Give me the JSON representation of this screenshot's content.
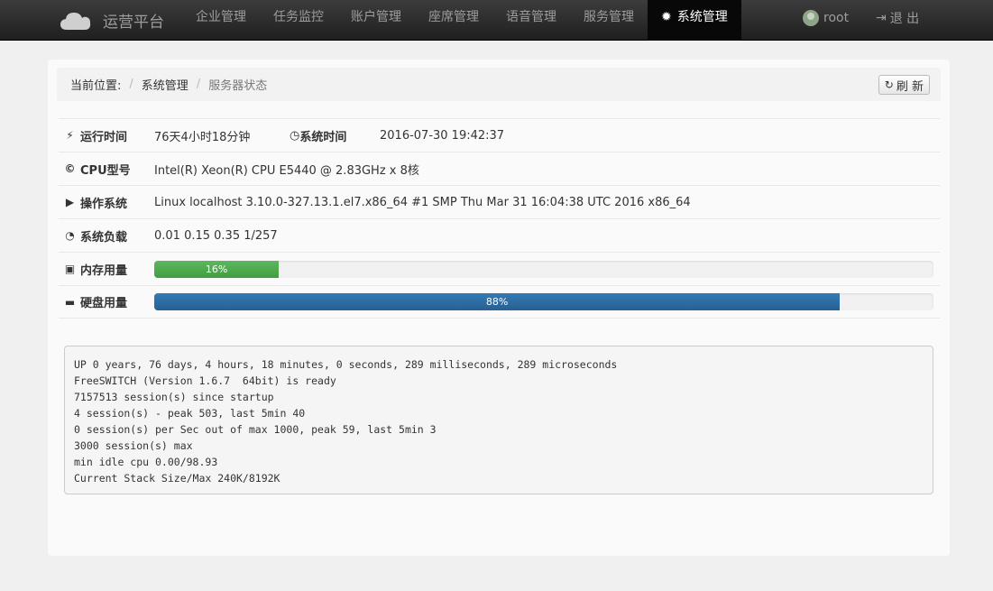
{
  "nav": {
    "brand": "运营平台",
    "items": [
      "企业管理",
      "任务监控",
      "账户管理",
      "座席管理",
      "语音管理",
      "服务管理"
    ],
    "active": "系统管理",
    "user": "root",
    "logout": "退 出"
  },
  "breadcrumb": {
    "prefix": "当前位置:",
    "level1": "系统管理",
    "level2": "服务器状态",
    "refresh": "刷 新"
  },
  "status": {
    "uptime_label": "运行时间",
    "uptime_value": "76天4小时18分钟",
    "systime_label": "系统时间",
    "systime_value": "2016-07-30 19:42:37",
    "cpu_label": "CPU型号",
    "cpu_value": "Intel(R) Xeon(R) CPU E5440 @ 2.83GHz x 8核",
    "os_label": "操作系统",
    "os_value": "Linux localhost 3.10.0-327.13.1.el7.x86_64 #1 SMP Thu Mar 31 16:04:38 UTC 2016 x86_64",
    "load_label": "系统负载",
    "load_value": "0.01 0.15 0.35 1/257",
    "mem_label": "内存用量",
    "mem_percent": 16,
    "mem_text": "16%",
    "disk_label": "硬盘用量",
    "disk_percent": 88,
    "disk_text": "88%"
  },
  "console": "UP 0 years, 76 days, 4 hours, 18 minutes, 0 seconds, 289 milliseconds, 289 microseconds\nFreeSWITCH (Version 1.6.7  64bit) is ready\n7157513 session(s) since startup\n4 session(s) - peak 503, last 5min 40\n0 session(s) per Sec out of max 1000, peak 59, last 5min 3\n3000 session(s) max\nmin idle cpu 0.00/98.93\nCurrent Stack Size/Max 240K/8192K",
  "colors": {
    "memory_bar": "#5cb85c",
    "disk_bar": "#337ab7",
    "navbar": "#222222"
  }
}
